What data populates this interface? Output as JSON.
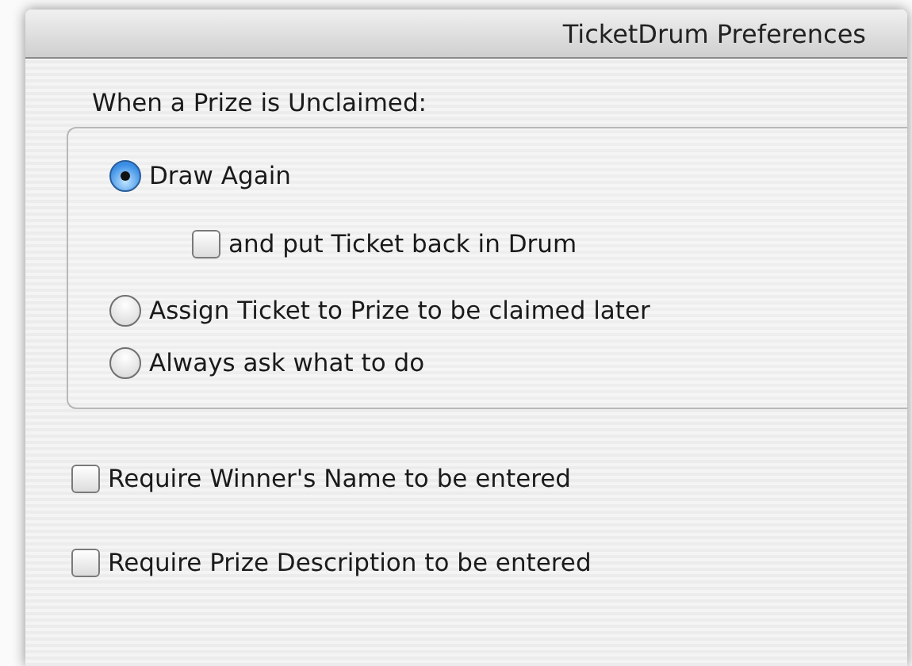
{
  "window": {
    "title": "TicketDrum Preferences"
  },
  "unclaimed_group": {
    "label": "When a Prize is Unclaimed:",
    "options": [
      {
        "kind": "radio",
        "label": "Draw Again",
        "selected": true,
        "children": [
          {
            "kind": "checkbox",
            "label": "and put Ticket back in Drum",
            "checked": false
          }
        ]
      },
      {
        "kind": "radio",
        "label": "Assign Ticket to Prize to be claimed later",
        "selected": false
      },
      {
        "kind": "radio",
        "label": "Always ask what to do",
        "selected": false
      }
    ]
  },
  "checkboxes": [
    {
      "label": "Require Winner's Name to be entered",
      "checked": false
    },
    {
      "label": "Require Prize Description to be entered",
      "checked": false
    }
  ]
}
